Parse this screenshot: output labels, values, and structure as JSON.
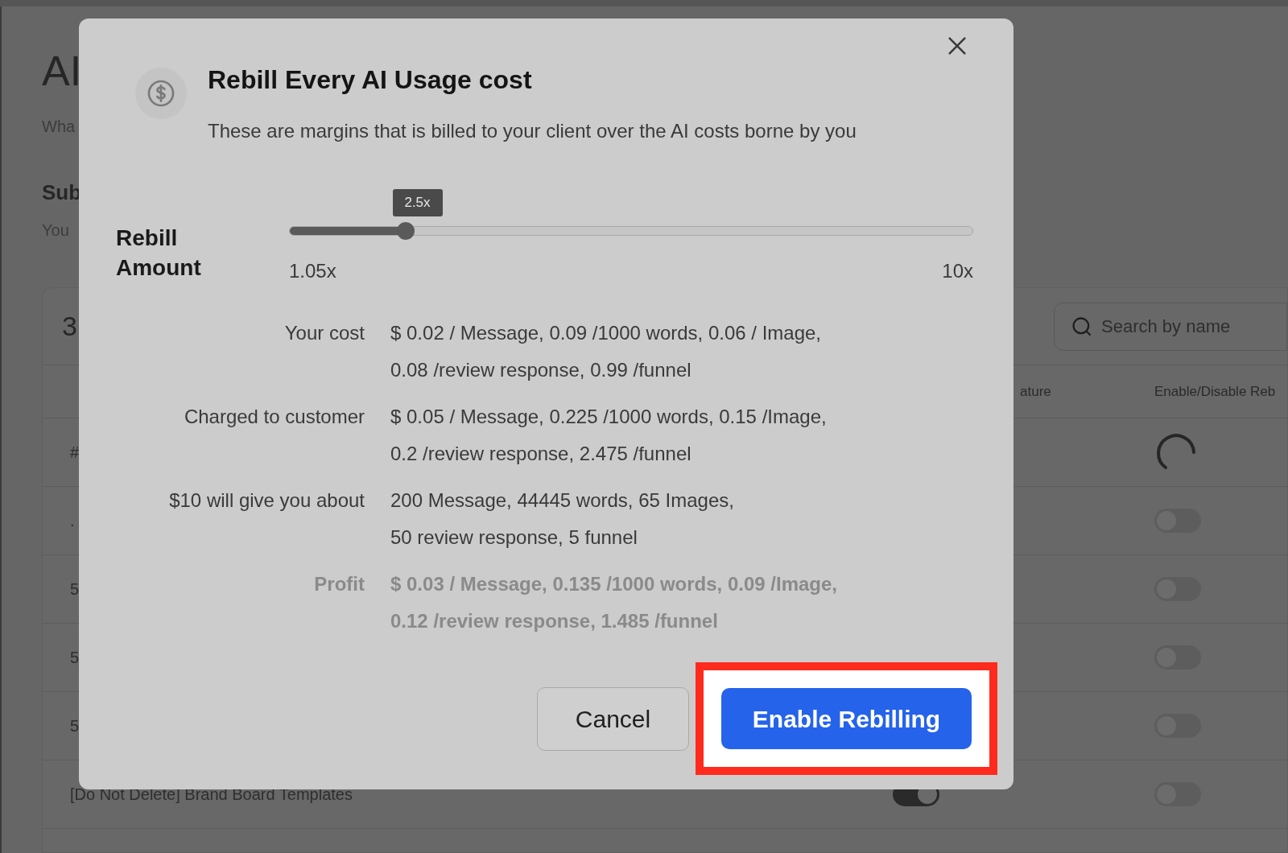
{
  "page": {
    "title": "AI",
    "subtitle": "Wha",
    "section_title": "Sub",
    "section_text": "You"
  },
  "table": {
    "count": "3",
    "search": {
      "placeholder": "Search by name"
    },
    "columns": [
      "ature",
      "Enable/Disable Reb"
    ],
    "rows": [
      {
        "name": "#",
        "feature_on": null,
        "kind": "loading",
        "enabled": false
      },
      {
        "name": ".",
        "feature_on": null,
        "kind": "toggle",
        "enabled": false
      },
      {
        "name": "5",
        "feature_on": null,
        "kind": "toggle",
        "enabled": false
      },
      {
        "name": "5",
        "feature_on": null,
        "kind": "toggle",
        "enabled": false
      },
      {
        "name": "5",
        "feature_on": null,
        "kind": "toggle",
        "enabled": false
      },
      {
        "name": "[Do Not Delete] Brand Board Templates",
        "feature_on": true,
        "kind": "toggle",
        "enabled": false
      }
    ]
  },
  "dialog": {
    "title": "Rebill Every AI Usage cost",
    "description": "These are margins that is billed to your client over the AI costs borne by you",
    "slider": {
      "label": "Rebill Amount",
      "tooltip": "2.5x",
      "level": 0.17,
      "min_label": "1.05x",
      "max_label": "10x"
    },
    "details": [
      {
        "label": "Your cost",
        "lines": [
          "$ 0.02 / Message, 0.09 /1000 words, 0.06 / Image,",
          "0.08 /review response, 0.99 /funnel"
        ],
        "kind": "normal"
      },
      {
        "label": "Charged to customer",
        "lines": [
          "$ 0.05 / Message, 0.225 /1000 words, 0.15 /Image,",
          "0.2 /review response, 2.475 /funnel"
        ],
        "kind": "normal"
      },
      {
        "label": "$10 will give you about",
        "lines": [
          "200 Message, 44445 words, 65 Images,",
          "50 review response, 5 funnel"
        ],
        "kind": "normal"
      },
      {
        "label": "Profit",
        "lines": [
          "$ 0.03 / Message, 0.135 /1000 words, 0.09 /Image,",
          "0.12 /review response, 1.485 /funnel"
        ],
        "kind": "profit"
      }
    ],
    "cancel": "Cancel",
    "confirm": {
      "label": "Enable Rebilling",
      "highlighted": true
    }
  }
}
